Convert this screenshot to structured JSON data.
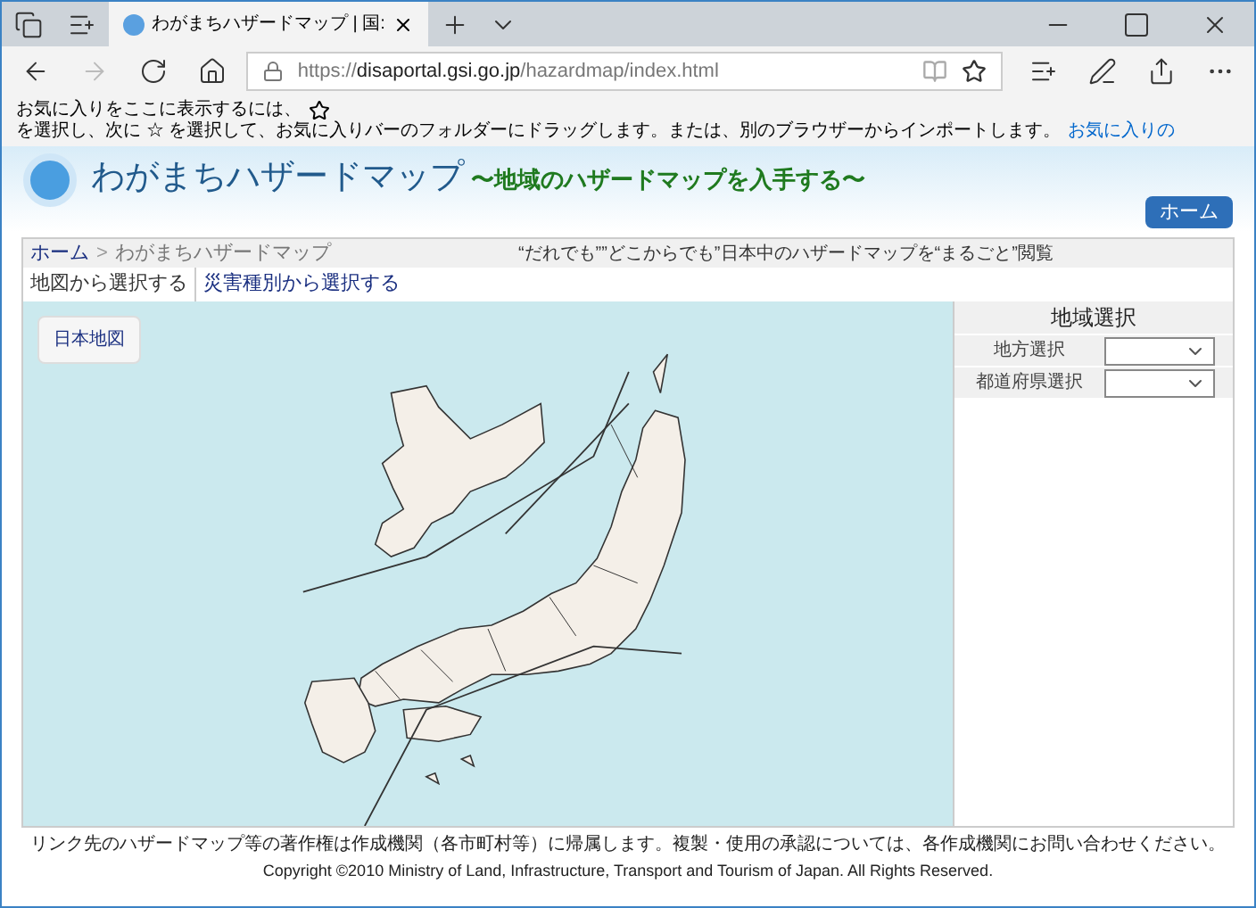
{
  "browser": {
    "tab_title": "わがまちハザードマップ | 国:",
    "url_host": "https://disaportal.gsi.go.jp",
    "url_path": "/hazardmap/index.html",
    "favorites_bar": {
      "text_before": "お気に入りをここに表示するには、",
      "text_after": "を選択し、次に ☆ を選択して、お気に入りバーのフォルダーにドラッグします。または、別のブラウザーからインポートします。",
      "link": "お気に入りの"
    }
  },
  "header": {
    "site_title": "わがまちハザードマップ",
    "subtitle": "〜地域のハザードマップを入手する〜",
    "home_button": "ホーム"
  },
  "breadcrumb": {
    "items": [
      "ホーム",
      "わがまちハザードマップ"
    ],
    "separator": ">",
    "tagline": "“だれでも””どこからでも”日本中のハザードマップを“まるごと”閲覧"
  },
  "tabs": [
    {
      "label": "地図から選択する",
      "selected": true
    },
    {
      "label": "災害種別から選択する",
      "selected": false
    }
  ],
  "map": {
    "button": "日本地図"
  },
  "region_panel": {
    "title": "地域選択",
    "fields": [
      {
        "label": "地方選択"
      },
      {
        "label": "都道府県選択"
      }
    ]
  },
  "footer": {
    "notice": "リンク先のハザードマップ等の著作権は作成機関（各市町村等）に帰属します。複製・使用の承認については、各作成機関にお問い合わせください。",
    "copyright": "Copyright ©2010 Ministry of Land, Infrastructure, Transport and Tourism of Japan. All Rights Reserved."
  }
}
